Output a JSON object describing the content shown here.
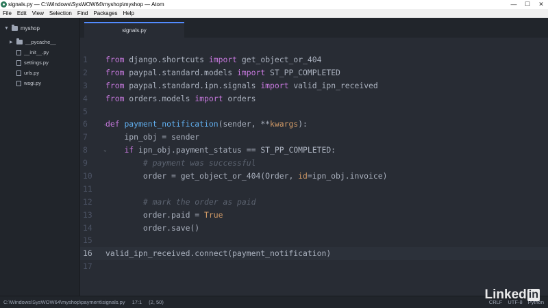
{
  "window": {
    "title": "signals.py — C:\\Windows\\SysWOW64\\myshop\\myshop — Atom"
  },
  "menu": [
    "File",
    "Edit",
    "View",
    "Selection",
    "Find",
    "Packages",
    "Help"
  ],
  "sidebar": {
    "root": "myshop",
    "items": [
      {
        "label": "__pycache__",
        "type": "folder"
      },
      {
        "label": "__init__.py",
        "type": "file"
      },
      {
        "label": "settings.py",
        "type": "file"
      },
      {
        "label": "urls.py",
        "type": "file"
      },
      {
        "label": "wsgi.py",
        "type": "file"
      }
    ]
  },
  "tab": {
    "label": "signals.py"
  },
  "code": {
    "active_line": 16,
    "lines": [
      {
        "n": "1",
        "tokens": [
          [
            "kw",
            "from"
          ],
          [
            "t",
            " django.shortcuts "
          ],
          [
            "kw",
            "import"
          ],
          [
            "t",
            " get_object_or_404"
          ]
        ]
      },
      {
        "n": "2",
        "tokens": [
          [
            "kw",
            "from"
          ],
          [
            "t",
            " paypal.standard.models "
          ],
          [
            "kw",
            "import"
          ],
          [
            "t",
            " ST_PP_COMPLETED"
          ]
        ]
      },
      {
        "n": "3",
        "tokens": [
          [
            "kw",
            "from"
          ],
          [
            "t",
            " paypal.standard.ipn.signals "
          ],
          [
            "kw",
            "import"
          ],
          [
            "t",
            " valid_ipn_received"
          ]
        ]
      },
      {
        "n": "4",
        "tokens": [
          [
            "kw",
            "from"
          ],
          [
            "t",
            " orders.models "
          ],
          [
            "kw",
            "import"
          ],
          [
            "t",
            " orders"
          ]
        ]
      },
      {
        "n": "5",
        "tokens": []
      },
      {
        "n": "6",
        "tokens": [
          [
            "kw",
            "def"
          ],
          [
            "t",
            " "
          ],
          [
            "fn",
            "payment_notification"
          ],
          [
            "t",
            "(sender, **"
          ],
          [
            "num",
            "kwargs"
          ],
          [
            "t",
            "):"
          ]
        ]
      },
      {
        "n": "7",
        "tokens": [
          [
            "t",
            "    ipn_obj = sender"
          ]
        ]
      },
      {
        "n": "8",
        "tokens": [
          [
            "t",
            "    "
          ],
          [
            "kw",
            "if"
          ],
          [
            "t",
            " ipn_obj.payment_status == ST_PP_COMPLETED:"
          ]
        ]
      },
      {
        "n": "9",
        "tokens": [
          [
            "t",
            "        "
          ],
          [
            "cmt",
            "# payment was successful"
          ]
        ]
      },
      {
        "n": "10",
        "tokens": [
          [
            "t",
            "        order = get_object_or_404(Order, "
          ],
          [
            "num",
            "id"
          ],
          [
            "t",
            "=ipn_obj.invoice)"
          ]
        ]
      },
      {
        "n": "11",
        "tokens": []
      },
      {
        "n": "12",
        "tokens": [
          [
            "t",
            "        "
          ],
          [
            "cmt",
            "# mark the order as paid"
          ]
        ]
      },
      {
        "n": "13",
        "tokens": [
          [
            "t",
            "        order.paid = "
          ],
          [
            "num",
            "True"
          ]
        ]
      },
      {
        "n": "14",
        "tokens": [
          [
            "t",
            "        order.save()"
          ]
        ]
      },
      {
        "n": "15",
        "tokens": []
      },
      {
        "n": "16",
        "tokens": [
          [
            "t",
            "valid_ipn_received.connect(payment_notification)"
          ]
        ]
      },
      {
        "n": "17",
        "tokens": []
      }
    ],
    "fold_lines": [
      "6",
      "8"
    ]
  },
  "status": {
    "path": "C:\\Windows\\SysWOW64\\myshop\\payment\\signals.py",
    "cursor": "17:1",
    "selection": "(2, 50)",
    "line_ending": "CRLF",
    "encoding": "UTF-8",
    "grammar": "Python"
  },
  "watermark": {
    "text": "Linked",
    "box": "in"
  }
}
